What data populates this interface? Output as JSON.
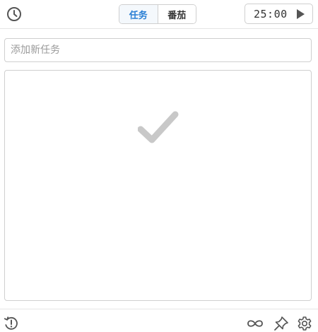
{
  "header": {
    "tabs": [
      {
        "label": "任务",
        "active": true
      },
      {
        "label": "番茄",
        "active": false
      }
    ],
    "timer": {
      "value": "25:00"
    }
  },
  "task_input": {
    "placeholder": "添加新任务",
    "value": ""
  },
  "task_list": {
    "items": [],
    "empty_icon": "check-icon"
  },
  "icons": {
    "history": "clock-icon",
    "play": "play-icon",
    "footer_left": "history-alert-icon",
    "footer_right": [
      "infinity-icon",
      "pin-icon",
      "gear-icon"
    ]
  },
  "colors": {
    "accent": "#2a7fd4",
    "icon": "#555555",
    "empty_check": "#c8c8c8"
  }
}
